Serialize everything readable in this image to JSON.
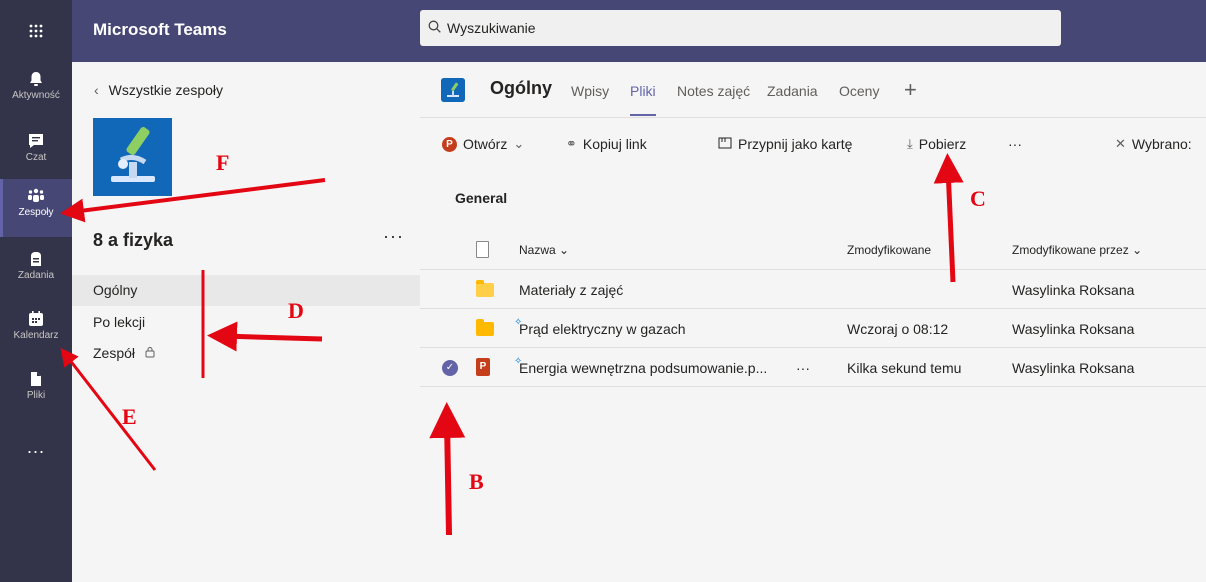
{
  "app": {
    "name": "Microsoft Teams",
    "waffle_icon": "app-launcher-icon"
  },
  "search": {
    "placeholder": "Wyszukiwanie",
    "icon": "search-icon"
  },
  "rail": [
    {
      "label": "Aktywność",
      "icon": "bell-icon"
    },
    {
      "label": "Czat",
      "icon": "chat-icon"
    },
    {
      "label": "Zespoły",
      "icon": "teams-icon",
      "active": true
    },
    {
      "label": "Zadania",
      "icon": "assignments-icon"
    },
    {
      "label": "Kalendarz",
      "icon": "calendar-icon"
    },
    {
      "label": "Pliki",
      "icon": "files-icon"
    },
    {
      "label": "...",
      "icon": "more-icon"
    }
  ],
  "panel": {
    "back_label": "Wszystkie zespoły",
    "team_name": "8 a fizyka",
    "more": "···",
    "channels": [
      {
        "label": "Ogólny",
        "active": true
      },
      {
        "label": "Po lekcji"
      },
      {
        "label": "Zespół"
      }
    ]
  },
  "channel_header": {
    "title": "Ogólny",
    "tabs": [
      "Wpisy",
      "Pliki",
      "Notes zajęć",
      "Zadania",
      "Oceny"
    ],
    "active_tab": "Pliki",
    "add": "+"
  },
  "toolbar": {
    "open": "Otwórz",
    "copy_link": "Kopiuj link",
    "pin": "Przypnij jako kartę",
    "download": "Pobierz",
    "more": "···",
    "selected": "Wybrano:"
  },
  "section": "General",
  "table": {
    "headers": {
      "name": "Nazwa",
      "modified": "Zmodyfikowane",
      "modified_by": "Zmodyfikowane przez"
    },
    "rows": [
      {
        "name": "Materiały z zajęć",
        "modified": "",
        "modified_by": "Wasylinka Roksana",
        "type": "folder-link"
      },
      {
        "name": "Prąd elektryczny w gazach",
        "modified": "Wczoraj o 08:12",
        "modified_by": "Wasylinka Roksana",
        "type": "folder"
      },
      {
        "name": "Energia wewnętrzna podsumowanie.p...",
        "modified": "Kilka sekund temu",
        "modified_by": "Wasylinka Roksana",
        "type": "pptx",
        "more": "···"
      }
    ]
  },
  "annotations": {
    "B": "B",
    "C": "C",
    "D": "D",
    "E": "E",
    "F": "F",
    "color": "#e30613"
  }
}
